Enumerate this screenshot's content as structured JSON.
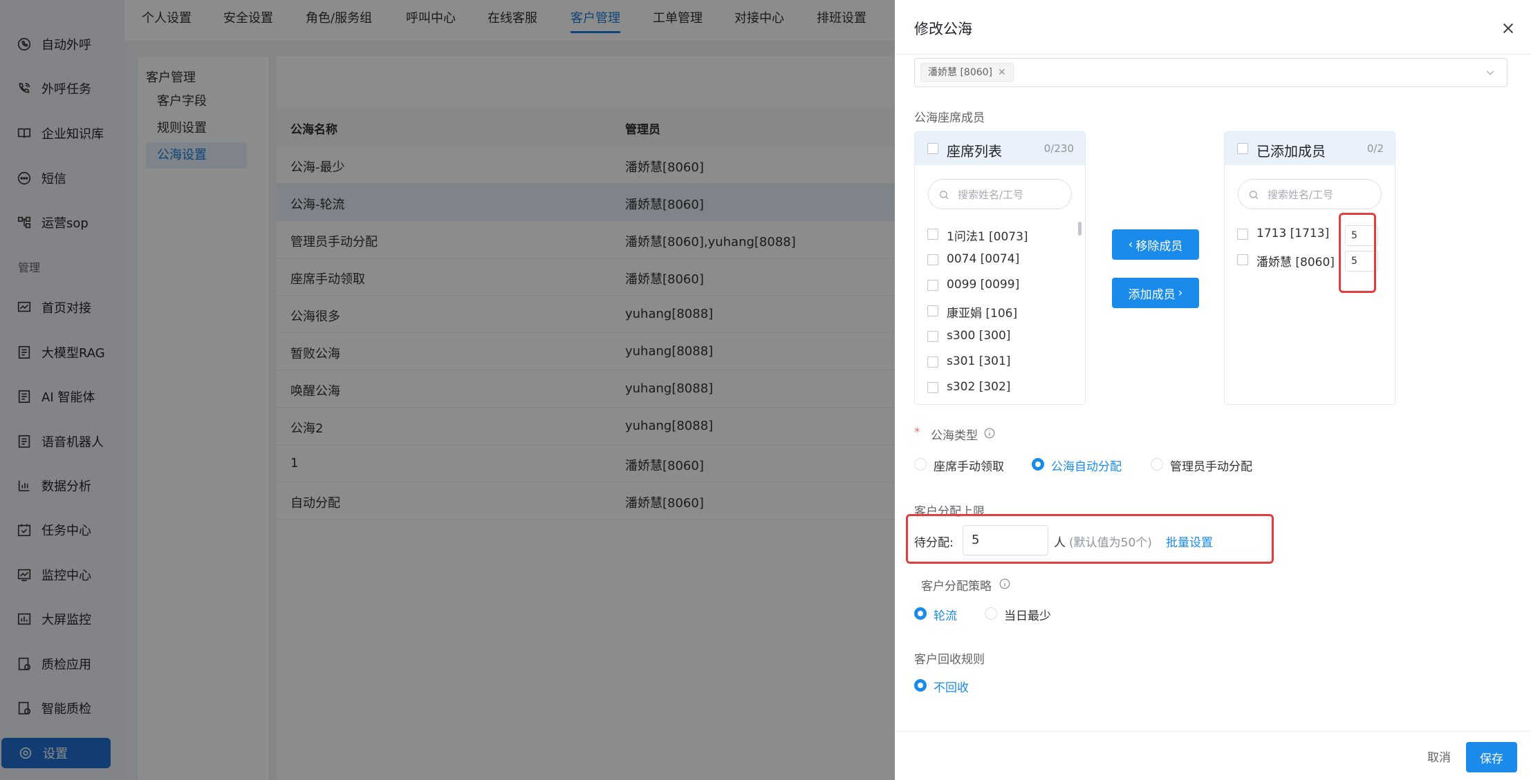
{
  "sidebar": {
    "items": [
      {
        "label": "自动外呼",
        "icon": "phone-outgoing-icon"
      },
      {
        "label": "外呼任务",
        "icon": "phone-call-icon"
      },
      {
        "label": "企业知识库",
        "icon": "book-icon"
      },
      {
        "label": "短信",
        "icon": "message-icon"
      },
      {
        "label": "运营sop",
        "icon": "flow-icon"
      }
    ],
    "group_label": "管理",
    "manage_items": [
      {
        "label": "首页对接",
        "icon": "chart-line-icon"
      },
      {
        "label": "大模型RAG",
        "icon": "document-icon"
      },
      {
        "label": "AI 智能体",
        "icon": "document-icon"
      },
      {
        "label": "语音机器人",
        "icon": "document-icon"
      },
      {
        "label": "数据分析",
        "icon": "bar-chart-icon"
      },
      {
        "label": "任务中心",
        "icon": "calendar-check-icon"
      },
      {
        "label": "监控中心",
        "icon": "monitor-chart-icon"
      },
      {
        "label": "大屏监控",
        "icon": "bar-chart-icon"
      },
      {
        "label": "质检应用",
        "icon": "doc-check-icon"
      },
      {
        "label": "智能质检",
        "icon": "doc-check-icon"
      }
    ],
    "active_label": "设置"
  },
  "topnav": {
    "tabs": [
      "个人设置",
      "安全设置",
      "角色/服务组",
      "呼叫中心",
      "在线客服",
      "客户管理",
      "工单管理",
      "对接中心",
      "排班设置"
    ],
    "active_index": 5
  },
  "subnav": {
    "title": "客户管理",
    "items": [
      "客户字段",
      "规则设置",
      "公海设置"
    ],
    "active_index": 2
  },
  "table": {
    "headers": [
      "公海名称",
      "管理员"
    ],
    "rows": [
      [
        "公海-最少",
        "潘娇慧[8060]"
      ],
      [
        "公海-轮流",
        "潘娇慧[8060]"
      ],
      [
        "管理员手动分配",
        "潘娇慧[8060],yuhang[8088]"
      ],
      [
        "座席手动领取",
        "潘娇慧[8060]"
      ],
      [
        "公海很多",
        "yuhang[8088]"
      ],
      [
        "暂败公海",
        "yuhang[8088]"
      ],
      [
        "唤醒公海",
        "yuhang[8088]"
      ],
      [
        "公海2",
        "yuhang[8088]"
      ],
      [
        "1",
        "潘娇慧[8060]"
      ],
      [
        "自动分配",
        "潘娇慧[8060]"
      ]
    ]
  },
  "drawer": {
    "title": "修改公海",
    "admin_tag": "潘娇慧 [8060]",
    "members_label": "公海座席成员",
    "left_panel": {
      "title": "座席列表",
      "count": "0/230",
      "search_placeholder": "搜索姓名/工号",
      "items": [
        "1问法1 [0073]",
        "0074 [0074]",
        "0099 [0099]",
        "康亚娟 [106]",
        "s300 [300]",
        "s301 [301]",
        "s302 [302]"
      ]
    },
    "right_panel": {
      "title": "已添加成员",
      "count": "0/2",
      "search_placeholder": "搜索姓名/工号",
      "items": [
        {
          "name": "1713 [1713]",
          "limit": "5"
        },
        {
          "name": "潘娇慧 [8060]",
          "limit": "5"
        }
      ]
    },
    "remove_button": "移除成员",
    "add_button": "添加成员",
    "type_required_mark": "*",
    "type_label": "公海类型",
    "type_options": [
      "座席手动领取",
      "公海自动分配",
      "管理员手动分配"
    ],
    "type_selected": 1,
    "limit_section_label": "客户分配上限",
    "pending_label": "待分配:",
    "pending_value": "5",
    "pending_unit": "人",
    "pending_hint": "(默认值为50个)",
    "batch_link": "批量设置",
    "strategy_label": "客户分配策略",
    "strategy_options": [
      "轮流",
      "当日最少"
    ],
    "strategy_selected": 0,
    "recycle_label": "客户回收规则",
    "recycle_options": [
      "不回收"
    ],
    "cancel_button": "取消",
    "save_button": "保存"
  }
}
